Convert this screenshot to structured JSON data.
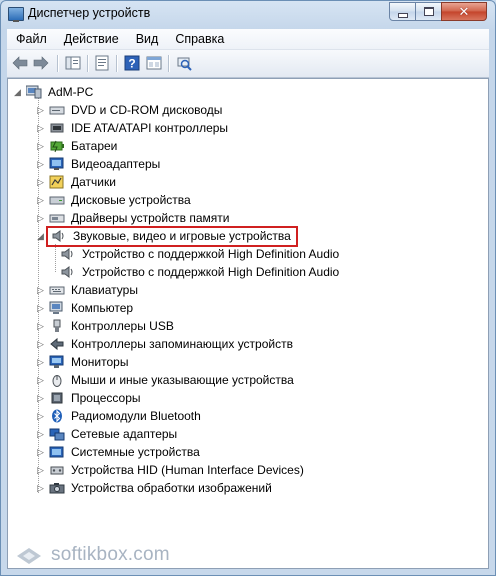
{
  "window": {
    "title": "Диспетчер устройств",
    "controls": {
      "minimize": "",
      "maximize": "",
      "close": "✕"
    }
  },
  "menu": [
    "Файл",
    "Действие",
    "Вид",
    "Справка"
  ],
  "toolbar_icons": [
    "back-arrow-icon",
    "forward-arrow-icon",
    "show-hide-tree-icon",
    "properties-icon",
    "help-icon",
    "view-icon",
    "scan-hardware-icon"
  ],
  "tree": {
    "root": "AdM-PC",
    "categories": [
      {
        "label": "DVD и CD-ROM дисководы",
        "icon": "dvd-drive-icon",
        "expanded": false
      },
      {
        "label": "IDE ATA/ATAPI контроллеры",
        "icon": "ide-controller-icon",
        "expanded": false
      },
      {
        "label": "Батареи",
        "icon": "battery-icon",
        "expanded": false
      },
      {
        "label": "Видеоадаптеры",
        "icon": "display-adapter-icon",
        "expanded": false
      },
      {
        "label": "Датчики",
        "icon": "sensor-icon",
        "expanded": false
      },
      {
        "label": "Дисковые устройства",
        "icon": "disk-drive-icon",
        "expanded": false
      },
      {
        "label": "Драйверы устройств памяти",
        "icon": "memory-driver-icon",
        "expanded": false
      },
      {
        "label": "Звуковые, видео и игровые устройства",
        "icon": "speaker-icon",
        "expanded": true,
        "highlighted": true,
        "children": [
          "Устройство с поддержкой High Definition Audio",
          "Устройство с поддержкой High Definition Audio"
        ]
      },
      {
        "label": "Клавиатуры",
        "icon": "keyboard-icon",
        "expanded": false
      },
      {
        "label": "Компьютер",
        "icon": "computer-icon",
        "expanded": false
      },
      {
        "label": "Контроллеры USB",
        "icon": "usb-icon",
        "expanded": false
      },
      {
        "label": "Контроллеры запоминающих устройств",
        "icon": "storage-controller-icon",
        "expanded": false
      },
      {
        "label": "Мониторы",
        "icon": "monitor-icon",
        "expanded": false
      },
      {
        "label": "Мыши и иные указывающие устройства",
        "icon": "mouse-icon",
        "expanded": false
      },
      {
        "label": "Процессоры",
        "icon": "processor-icon",
        "expanded": false
      },
      {
        "label": "Радиомодули Bluetooth",
        "icon": "bluetooth-icon",
        "expanded": false
      },
      {
        "label": "Сетевые адаптеры",
        "icon": "network-adapter-icon",
        "expanded": false
      },
      {
        "label": "Системные устройства",
        "icon": "system-device-icon",
        "expanded": false
      },
      {
        "label": "Устройства HID (Human Interface Devices)",
        "icon": "hid-icon",
        "expanded": false
      },
      {
        "label": "Устройства обработки изображений",
        "icon": "imaging-device-icon",
        "expanded": false
      }
    ]
  },
  "watermark": "softikbox.com",
  "colors": {
    "highlight_border": "#d02020",
    "window_frame": "#c4d6ea"
  }
}
